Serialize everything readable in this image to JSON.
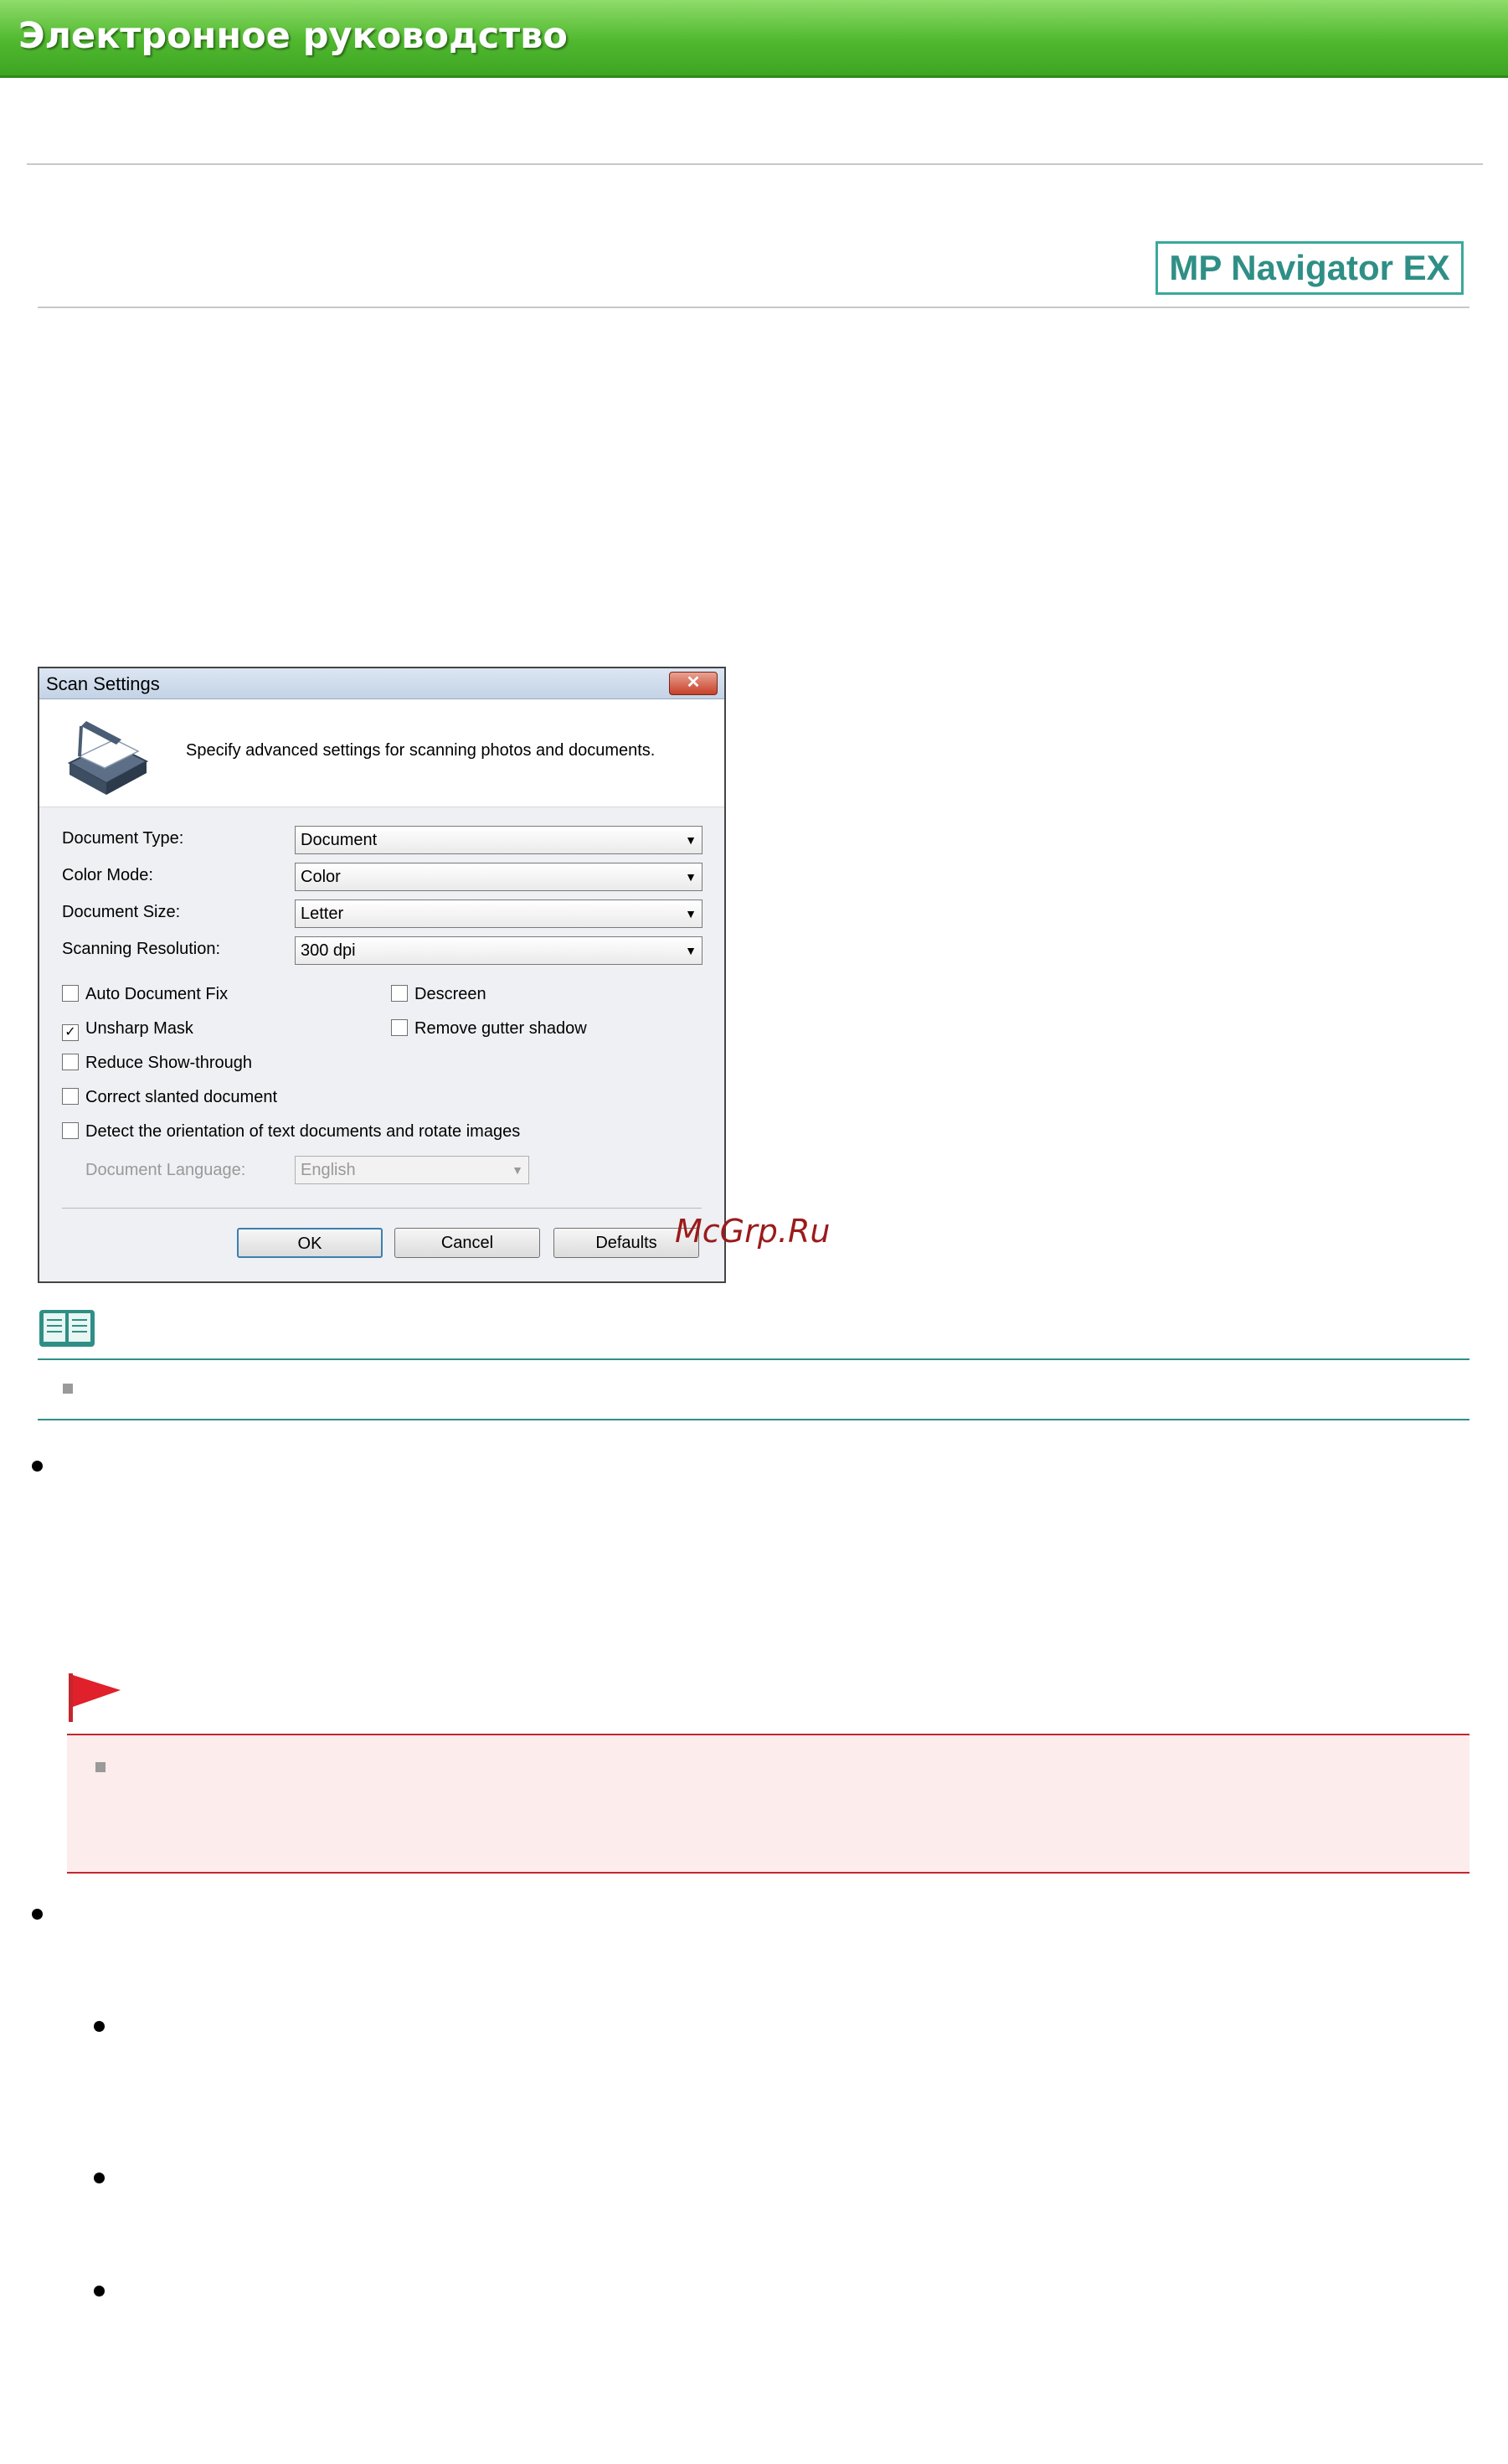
{
  "header": {
    "title": "Электронное руководство"
  },
  "badge": {
    "label": "MP Navigator EX"
  },
  "dialog": {
    "title": "Scan Settings",
    "close_glyph": "✕",
    "description": "Specify advanced settings for scanning photos and documents.",
    "fields": [
      {
        "label": "Document Type:",
        "value": "Document"
      },
      {
        "label": "Color Mode:",
        "value": "Color"
      },
      {
        "label": "Document Size:",
        "value": "Letter"
      },
      {
        "label": "Scanning Resolution:",
        "value": "300 dpi"
      }
    ],
    "checkboxes": {
      "auto_document_fix": {
        "label": "Auto Document Fix",
        "checked": false
      },
      "descreen": {
        "label": "Descreen",
        "checked": false
      },
      "unsharp_mask": {
        "label": "Unsharp Mask",
        "checked": true,
        "mark": "✓"
      },
      "remove_gutter_shadow": {
        "label": "Remove gutter shadow",
        "checked": false
      },
      "reduce_show_through": {
        "label": "Reduce Show-through",
        "checked": false
      },
      "correct_slanted": {
        "label": "Correct slanted document",
        "checked": false
      },
      "detect_orientation": {
        "label": "Detect the orientation of text documents and rotate images",
        "checked": false
      }
    },
    "document_language": {
      "label": "Document Language:",
      "value": "English"
    },
    "buttons": {
      "ok": "OK",
      "cancel": "Cancel",
      "defaults": "Defaults"
    },
    "dropdown_glyph": "▼"
  },
  "watermark": "McGrp.Ru",
  "colors": {
    "banner": "#4fb82e",
    "note_rule": "#2f8f86",
    "important_rule": "#c4262e",
    "important_bg": "#fcecec"
  },
  "icons": {
    "note": "note-book-icon",
    "important": "red-flag-icon",
    "scanner": "scanner-icon"
  }
}
